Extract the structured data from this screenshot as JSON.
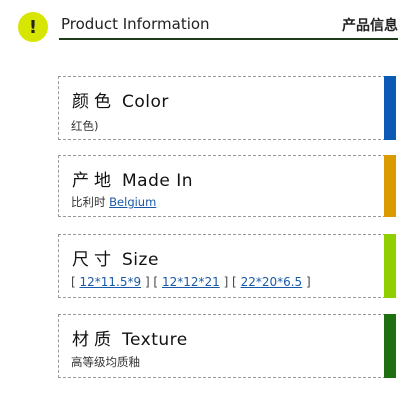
{
  "header": {
    "title_en": "Product Information",
    "title_zh": "产品信息",
    "alert_glyph": "!"
  },
  "cards": [
    {
      "heading_zh": "颜色",
      "heading_en": "Color",
      "value": "红色)",
      "accent": "#0b5bb5"
    },
    {
      "heading_zh": "产地",
      "heading_en": "Made In",
      "value_prefix": "比利时",
      "value_link": "Belgium",
      "accent": "#d99b00"
    },
    {
      "heading_zh": "尺寸",
      "heading_en": "Size",
      "sizes": [
        "12*11.5*9",
        "12*12*21",
        "22*20*6.5"
      ],
      "accent": "#8fcf00"
    },
    {
      "heading_zh": "材质",
      "heading_en": "Texture",
      "value": "高等级均质釉",
      "accent": "#1f6e12"
    }
  ]
}
